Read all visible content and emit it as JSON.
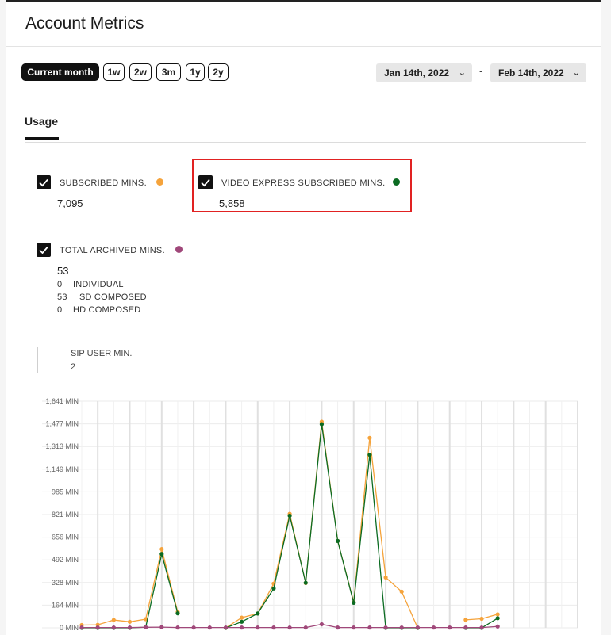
{
  "header": {
    "title": "Account Metrics"
  },
  "range_buttons": [
    {
      "label": "Current month",
      "active": true
    },
    {
      "label": "1w"
    },
    {
      "label": "2w"
    },
    {
      "label": "3m"
    },
    {
      "label": "1y"
    },
    {
      "label": "2y"
    }
  ],
  "date_range": {
    "start": "Jan 14th, 2022",
    "separator": "-",
    "end": "Feb 14th, 2022"
  },
  "tabs": [
    {
      "label": "Usage",
      "active": true
    }
  ],
  "metrics": {
    "subscribed": {
      "label": "SUBSCRIBED MINS.",
      "value": "7,095",
      "color": "#f5a33b",
      "checked": true
    },
    "video_express": {
      "label": "VIDEO EXPRESS SUBSCRIBED MINS.",
      "value": "5,858",
      "color": "#0b6b22",
      "checked": true
    },
    "archived": {
      "label": "TOTAL ARCHIVED MINS.",
      "value": "53",
      "color": "#a0487a",
      "checked": true,
      "breakdown": [
        {
          "count": "0",
          "label": "INDIVIDUAL"
        },
        {
          "count": "53",
          "label": "SD COMPOSED"
        },
        {
          "count": "0",
          "label": "HD COMPOSED"
        }
      ]
    },
    "sip": {
      "label": "SIP USER MIN.",
      "value": "2"
    }
  },
  "chart_data": {
    "type": "line",
    "ylim": [
      0,
      1641
    ],
    "y_ticks": [
      "0 MIN",
      "164 MIN",
      "328 MIN",
      "492 MIN",
      "656 MIN",
      "821 MIN",
      "985 MIN",
      "1,149 MIN",
      "1,313 MIN",
      "1,477 MIN",
      "1,641 MIN"
    ],
    "x_count": 32,
    "grid": true,
    "series": [
      {
        "name": "SUBSCRIBED MINS.",
        "color": "#f5a33b",
        "values": [
          20,
          22,
          57,
          44,
          63,
          570,
          115,
          null,
          null,
          0,
          74,
          104,
          320,
          826,
          325,
          1492,
          629,
          186,
          1375,
          365,
          262,
          0,
          null,
          null,
          58,
          66,
          98,
          null,
          null,
          null,
          null,
          null
        ]
      },
      {
        "name": "VIDEO EXPRESS SUBSCRIBED MINS.",
        "color": "#0b6b22",
        "values": [
          0,
          0,
          0,
          0,
          4,
          535,
          105,
          null,
          null,
          0,
          44,
          104,
          285,
          812,
          326,
          1474,
          629,
          181,
          1253,
          0,
          0,
          0,
          null,
          null,
          0,
          0,
          70,
          null,
          null,
          null,
          null,
          null
        ]
      },
      {
        "name": "TOTAL ARCHIVED MINS.",
        "color": "#a0487a",
        "values": [
          2,
          2,
          2,
          2,
          4,
          5,
          2,
          2,
          2,
          2,
          2,
          2,
          2,
          2,
          2,
          26,
          2,
          2,
          2,
          2,
          2,
          2,
          2,
          2,
          2,
          2,
          10,
          null,
          null,
          null,
          null,
          null
        ]
      }
    ]
  }
}
